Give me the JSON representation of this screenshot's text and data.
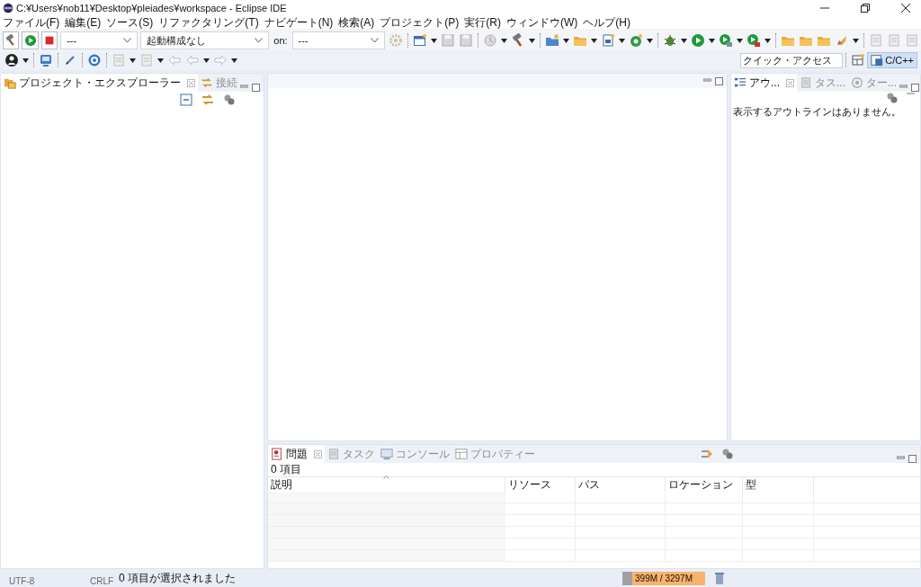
{
  "window": {
    "title": "C:¥Users¥nob11¥Desktop¥pleiades¥workspace - Eclipse IDE"
  },
  "menu": [
    "ファイル(F)",
    "編集(E)",
    "ソース(S)",
    "リファクタリング(T)",
    "ナビゲート(N)",
    "検索(A)",
    "プロジェクト(P)",
    "実行(R)",
    "ウィンドウ(W)",
    "ヘルプ(H)"
  ],
  "toolbar": {
    "mode_combo": {
      "value": "---"
    },
    "launch_combo": {
      "value": "起動構成なし"
    },
    "on_label": "on:",
    "target_combo": {
      "value": "---"
    }
  },
  "quick_access": {
    "placeholder": "クイック・アクセス"
  },
  "perspective": {
    "label": "C/C++",
    "selected": true
  },
  "left_panel": {
    "tabs": [
      {
        "label": "プロジェクト・エクスプローラー",
        "selected": true
      },
      {
        "label": "接続",
        "selected": false
      }
    ]
  },
  "right_panel": {
    "tabs": [
      {
        "label": "アウ...",
        "selected": true
      },
      {
        "label": "タス...",
        "selected": false
      },
      {
        "label": "ター...",
        "selected": false
      }
    ],
    "message": "表示するアウトラインはありません。"
  },
  "bottom_panel": {
    "tabs": [
      {
        "label": "問題",
        "selected": true
      },
      {
        "label": "タスク",
        "selected": false
      },
      {
        "label": "コンソール",
        "selected": false
      },
      {
        "label": "プロパティー",
        "selected": false
      }
    ],
    "summary": "0 項目",
    "columns": [
      "説明",
      "リソース",
      "パス",
      "ロケーション",
      "型"
    ]
  },
  "status_bar": {
    "encoding": "UTF-8",
    "line_ending": "CRLF",
    "message": "0 項目が選択されました",
    "heap": {
      "text": "399M / 3297M",
      "level": 0.12
    }
  }
}
